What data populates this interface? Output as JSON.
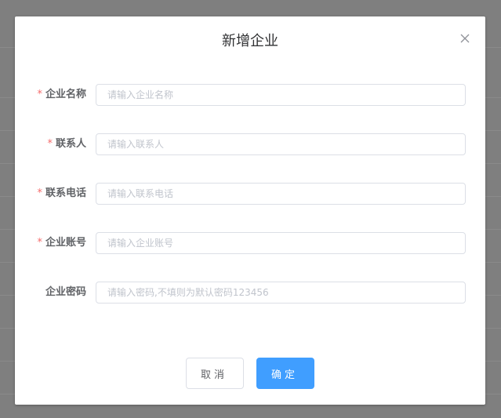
{
  "dialog": {
    "title": "新增企业",
    "close_icon": "close-icon"
  },
  "form": {
    "fields": [
      {
        "label": "企业名称",
        "required": true,
        "placeholder": "请输入企业名称",
        "value": ""
      },
      {
        "label": "联系人",
        "required": true,
        "placeholder": "请输入联系人",
        "value": ""
      },
      {
        "label": "联系电话",
        "required": true,
        "placeholder": "请输入联系电话",
        "value": ""
      },
      {
        "label": "企业账号",
        "required": true,
        "placeholder": "请输入企业账号",
        "value": ""
      },
      {
        "label": "企业密码",
        "required": false,
        "placeholder": "请输入密码,不填则为默认密码123456",
        "value": ""
      }
    ],
    "required_mark": "*"
  },
  "footer": {
    "cancel_label": "取消",
    "confirm_label": "确定"
  },
  "colors": {
    "primary": "#409eff",
    "required": "#f56c6c",
    "overlay": "#7f7f7f"
  }
}
